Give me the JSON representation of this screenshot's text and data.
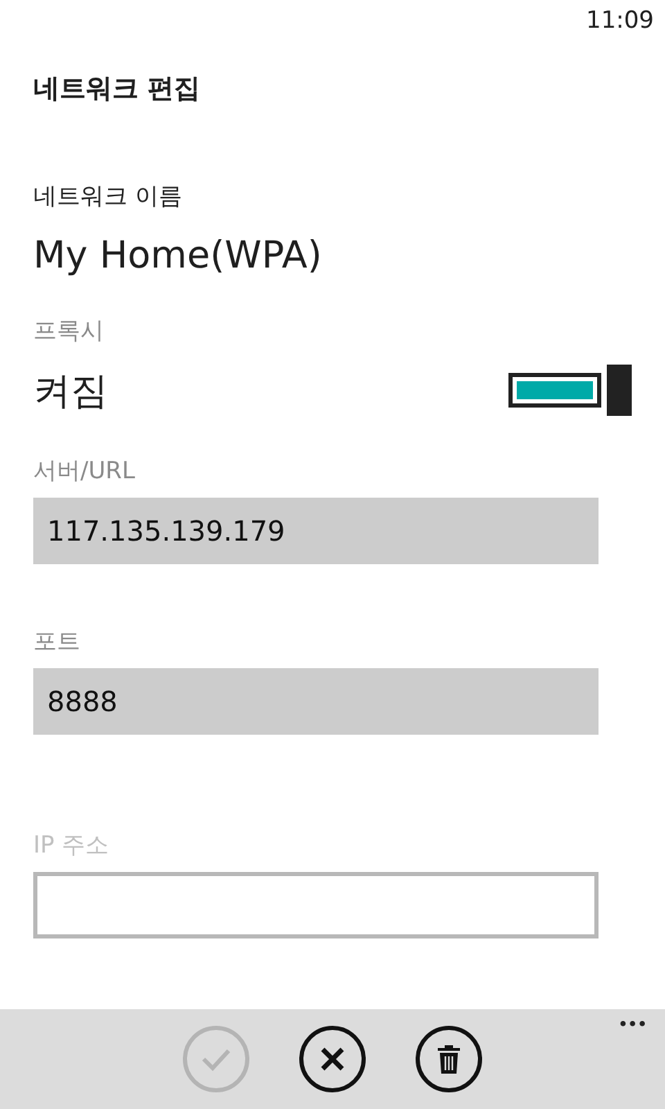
{
  "status_bar": {
    "time": "11:09"
  },
  "title": "네트워크 편집",
  "network_name": {
    "label": "네트워크 이름",
    "value": "My Home(WPA)"
  },
  "proxy": {
    "label": "프록시",
    "state_text": "켜짐",
    "on": true
  },
  "fields": [
    {
      "label": "서버/URL",
      "value": "117.135.139.179",
      "disabled": false
    },
    {
      "label": "포트",
      "value": "8888",
      "disabled": false
    },
    {
      "label": "IP 주소",
      "disabled": true
    }
  ],
  "app_bar": {
    "buttons": [
      {
        "kind": "check",
        "disabled": true
      },
      {
        "kind": "cancel",
        "disabled": false
      },
      {
        "kind": "delete",
        "disabled": false
      }
    ],
    "more": "•••"
  }
}
